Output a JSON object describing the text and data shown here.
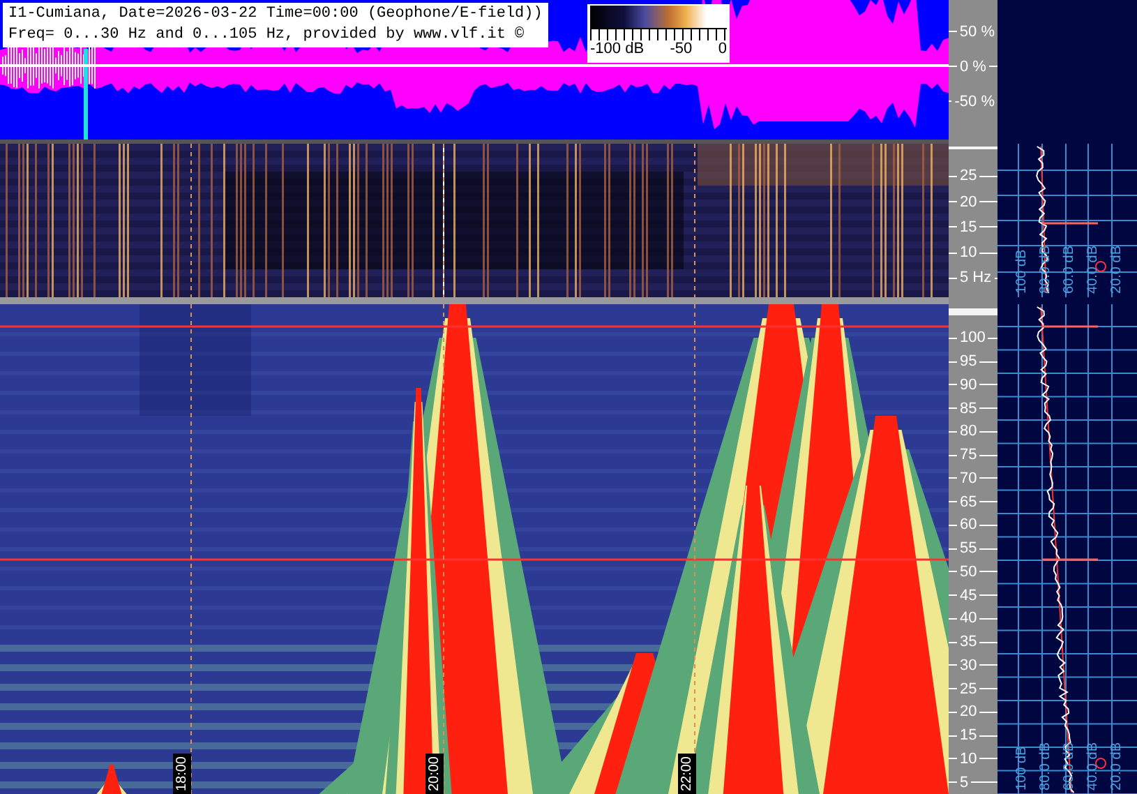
{
  "header": {
    "line_1": "I1-Cumiana, Date=2026-03-22 Time=00:00 (Geophone/E-field))",
    "line_2": "Freq= 0...30 Hz and 0...105 Hz, provided by www.vlf.it ©"
  },
  "colorbar": {
    "labels": [
      "-100 dB",
      "-50",
      "0"
    ]
  },
  "waveform_axis": [
    "50 %",
    "0 %",
    "-50 %"
  ],
  "low_band_axis": [
    "25",
    "20",
    "15",
    "10",
    "5 Hz"
  ],
  "high_band_axis": [
    "100",
    "95",
    "90",
    "85",
    "80",
    "75",
    "70",
    "65",
    "60",
    "55",
    "50",
    "45",
    "40",
    "35",
    "30",
    "25",
    "20",
    "15",
    "10",
    "5"
  ],
  "low_band_spectrum": {
    "db_labels": [
      "100 dB",
      "80.0 dB",
      "60.0 dB",
      "40.0 dB",
      "20.0 dB"
    ]
  },
  "high_band_spectrum": {
    "db_labels": [
      "100 dB",
      "80.0 dB",
      "60.0 dB",
      "40.0 dB",
      "20.0 dB"
    ]
  },
  "time_labels": [
    "18:00",
    "20:00",
    "22:00"
  ]
}
